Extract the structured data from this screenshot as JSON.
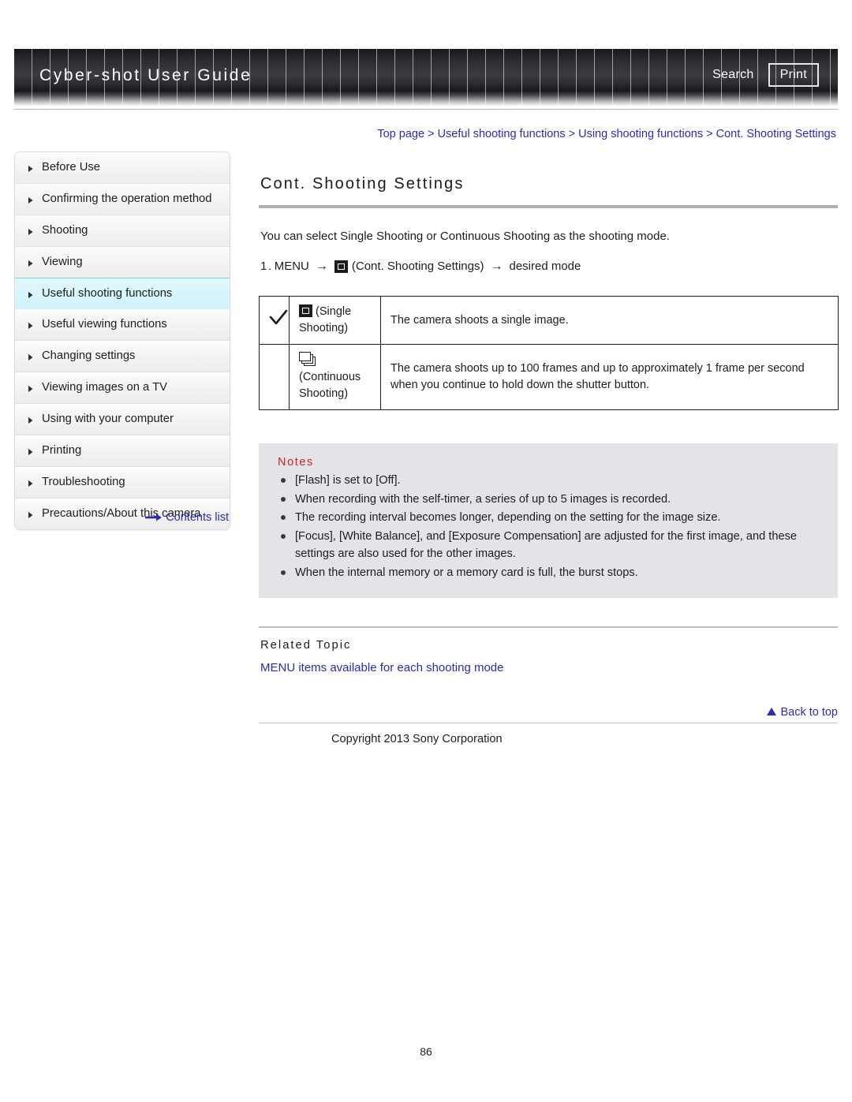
{
  "header": {
    "title": "Cyber-shot User Guide",
    "search_label": "Search",
    "print_label": "Print"
  },
  "breadcrumb": {
    "items": [
      "Top page",
      "Useful shooting functions",
      "Using shooting functions",
      "Cont. Shooting Settings"
    ],
    "separator": ">"
  },
  "sidebar": {
    "items": [
      {
        "label": "Before Use",
        "active": false
      },
      {
        "label": "Confirming the operation method",
        "active": false
      },
      {
        "label": "Shooting",
        "active": false
      },
      {
        "label": "Viewing",
        "active": false
      },
      {
        "label": "Useful shooting functions",
        "active": true
      },
      {
        "label": "Useful viewing functions",
        "active": false
      },
      {
        "label": "Changing settings",
        "active": false
      },
      {
        "label": "Viewing images on a TV",
        "active": false
      },
      {
        "label": "Using with your computer",
        "active": false
      },
      {
        "label": "Printing",
        "active": false
      },
      {
        "label": "Troubleshooting",
        "active": false
      },
      {
        "label": "Precautions/About this camera",
        "active": false
      }
    ],
    "contents_list_label": "Contents list"
  },
  "main": {
    "title": "Cont. Shooting Settings",
    "intro": "You can select Single Shooting or Continuous Shooting as the shooting mode.",
    "step": {
      "number": "1.",
      "menu_label": "MENU",
      "arrow": "→",
      "icon_name": "single-shooting-icon",
      "setting_label": "(Cont. Shooting Settings)",
      "target_label": "desired mode"
    },
    "table": {
      "rows": [
        {
          "checked": true,
          "icon": "single-shooting-icon",
          "mode": "(Single Shooting)",
          "description": "The camera shoots a single image."
        },
        {
          "checked": false,
          "icon": "continuous-shooting-icon",
          "mode": "(Continuous Shooting)",
          "description": "The camera shoots up to 100 frames and up to approximately 1 frame per second when you continue to hold down the shutter button."
        }
      ]
    },
    "notes": {
      "title": "Notes",
      "items": [
        "[Flash] is set to [Off].",
        "When recording with the self-timer, a series of up to 5 images is recorded.",
        "The recording interval becomes longer, depending on the setting for the image size.",
        "[Focus], [White Balance], and [Exposure Compensation] are adjusted for the first image, and these settings are also used for the other images.",
        "When the internal memory or a memory card is full, the burst stops."
      ]
    },
    "related": {
      "title": "Related Topic",
      "link": "MENU items available for each shooting mode"
    },
    "back_to_top": "Back to top",
    "copyright": "Copyright 2013 Sony Corporation",
    "page_number": "86"
  },
  "colors": {
    "link": "#2b2bb5",
    "notes_heading": "#d42026",
    "active_nav_bg": "#d4f3fb",
    "active_nav_border": "#74d6ea",
    "notes_bg": "#e3e4e8"
  }
}
